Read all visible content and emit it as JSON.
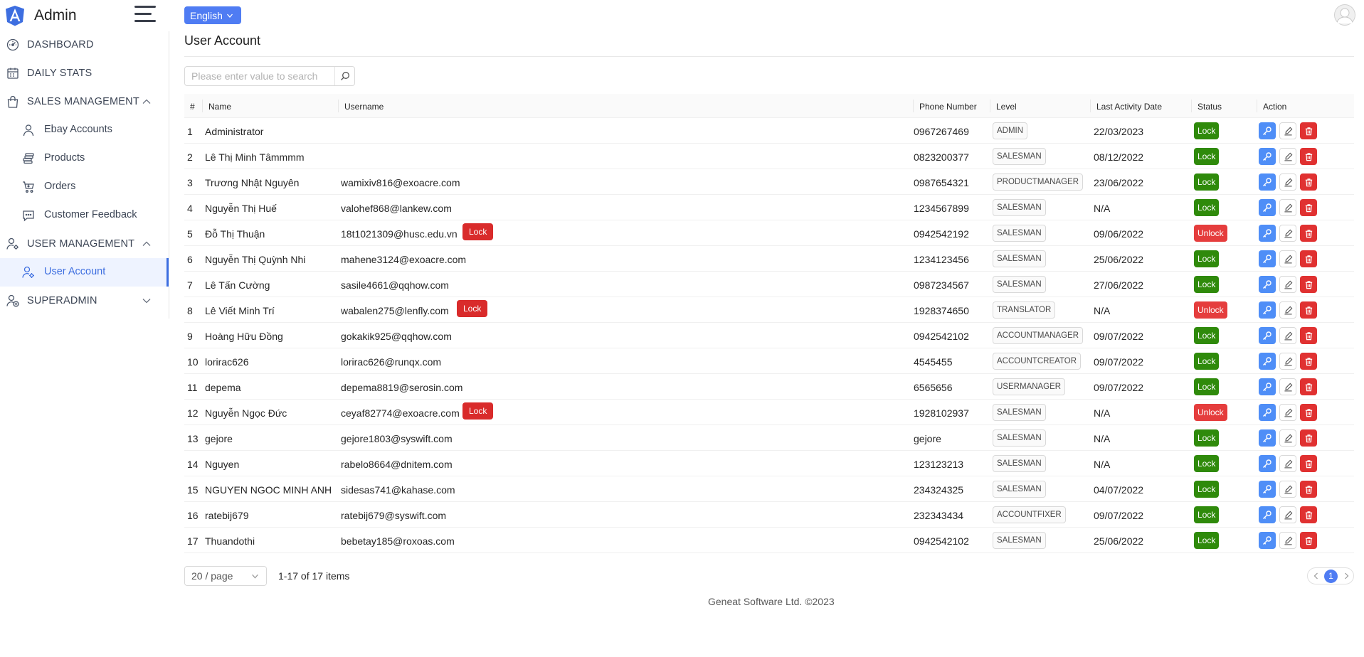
{
  "app": {
    "name": "Admin"
  },
  "header": {
    "language": "English"
  },
  "sidebar": {
    "items": [
      {
        "label": "DASHBOARD",
        "icon": "speedometer-icon"
      },
      {
        "label": "DAILY STATS",
        "icon": "calendar-icon"
      },
      {
        "label": "SALES MANAGEMENT",
        "icon": "shopping-bag-icon",
        "expanded": true,
        "children": [
          {
            "label": "Ebay Accounts",
            "icon": "user-icon"
          },
          {
            "label": "Products",
            "icon": "coins-icon"
          },
          {
            "label": "Orders",
            "icon": "cart-icon"
          },
          {
            "label": "Customer Feedback",
            "icon": "comment-icon"
          }
        ]
      },
      {
        "label": "USER MANAGEMENT",
        "icon": "user-gear-icon",
        "expanded": true,
        "children": [
          {
            "label": "User Account",
            "icon": "user-gear-icon",
            "active": true
          }
        ]
      },
      {
        "label": "SUPERADMIN",
        "icon": "user-plus-icon",
        "expanded": false
      }
    ]
  },
  "page": {
    "title": "User Account",
    "search_placeholder": "Please enter value to search"
  },
  "table": {
    "columns": [
      "#",
      "Name",
      "Username",
      "Phone Number",
      "Level",
      "Last Activity Date",
      "Status",
      "Action"
    ],
    "rows": [
      {
        "no": "1",
        "name": "Administrator",
        "username": "",
        "phone": "0967267469",
        "level": "ADMIN",
        "date": "22/03/2023",
        "status": "Lock",
        "locked": false
      },
      {
        "no": "2",
        "name": "Lê Thị Minh Tâmmmm",
        "username": "",
        "phone": "0823200377",
        "level": "SALESMAN",
        "date": "08/12/2022",
        "status": "Lock",
        "locked": false
      },
      {
        "no": "3",
        "name": "Trương Nhật Nguyên",
        "username": "wamixiv816@exoacre.com",
        "phone": "0987654321",
        "level": "PRODUCTMANAGER",
        "date": "23/06/2022",
        "status": "Lock",
        "locked": false
      },
      {
        "no": "4",
        "name": "Nguyễn Thị Huế",
        "username": "valohef868@lankew.com",
        "phone": "1234567899",
        "level": "SALESMAN",
        "date": "N/A",
        "status": "Lock",
        "locked": false
      },
      {
        "no": "5",
        "name": "Đỗ Thị Thuận",
        "username": "18t1021309@husc.edu.vn",
        "phone": "0942542192",
        "level": "SALESMAN",
        "date": "09/06/2022",
        "status": "Unlock",
        "locked": true,
        "lock_label": "Lock"
      },
      {
        "no": "6",
        "name": "Nguyễn Thị Quỳnh Nhi",
        "username": "mahene3124@exoacre.com",
        "phone": "1234123456",
        "level": "SALESMAN",
        "date": "25/06/2022",
        "status": "Lock",
        "locked": false
      },
      {
        "no": "7",
        "name": "Lê Tấn Cường",
        "username": "sasile4661@qqhow.com",
        "phone": "0987234567",
        "level": "SALESMAN",
        "date": "27/06/2022",
        "status": "Lock",
        "locked": false
      },
      {
        "no": "8",
        "name": "Lê Viết Minh Trí",
        "username": "wabalen275@lenfly.com",
        "phone": "1928374650",
        "level": "TRANSLATOR",
        "date": "N/A",
        "status": "Unlock",
        "locked": true,
        "lock_label": "Lock"
      },
      {
        "no": "9",
        "name": "Hoàng Hữu Đồng",
        "username": "gokakik925@qqhow.com",
        "phone": "0942542102",
        "level": "ACCOUNTMANAGER",
        "date": "09/07/2022",
        "status": "Lock",
        "locked": false
      },
      {
        "no": "10",
        "name": "lorirac626",
        "username": "lorirac626@runqx.com",
        "phone": "4545455",
        "level": "ACCOUNTCREATOR",
        "date": "09/07/2022",
        "status": "Lock",
        "locked": false
      },
      {
        "no": "11",
        "name": "depema",
        "username": "depema8819@serosin.com",
        "phone": "6565656",
        "level": "USERMANAGER",
        "date": "09/07/2022",
        "status": "Lock",
        "locked": false
      },
      {
        "no": "12",
        "name": "Nguyễn Ngọc Đức",
        "username": "ceyaf82774@exoacre.com",
        "phone": "1928102937",
        "level": "SALESMAN",
        "date": "N/A",
        "status": "Unlock",
        "locked": true,
        "lock_label": "Lock"
      },
      {
        "no": "13",
        "name": "gejore",
        "username": "gejore1803@syswift.com",
        "phone": "gejore",
        "level": "SALESMAN",
        "date": "N/A",
        "status": "Lock",
        "locked": false
      },
      {
        "no": "14",
        "name": "Nguyen",
        "username": "rabelo8664@dnitem.com",
        "phone": "123123213",
        "level": "SALESMAN",
        "date": "N/A",
        "status": "Lock",
        "locked": false
      },
      {
        "no": "15",
        "name": "NGUYEN NGOC MINH ANH",
        "username": "sidesas741@kahase.com",
        "phone": "234324325",
        "level": "SALESMAN",
        "date": "04/07/2022",
        "status": "Lock",
        "locked": false
      },
      {
        "no": "16",
        "name": "ratebij679",
        "username": "ratebij679@syswift.com",
        "phone": "232343434",
        "level": "ACCOUNTFIXER",
        "date": "09/07/2022",
        "status": "Lock",
        "locked": false
      },
      {
        "no": "17",
        "name": "Thuandothi",
        "username": "bebetay185@roxoas.com",
        "phone": "0942542102",
        "level": "SALESMAN",
        "date": "25/06/2022",
        "status": "Lock",
        "locked": false
      }
    ]
  },
  "pagination": {
    "page_size": "20 / page",
    "total": "1-17 of 17 items",
    "current": "1"
  },
  "footer": {
    "copyright": "Geneat Software Ltd. ©2023"
  },
  "colors": {
    "accent": "#4f7cf3",
    "lock_green": "#2f8a0b",
    "unlock_red": "#e53d3d",
    "delete_red": "#e03131",
    "key_blue": "#4f8ef7"
  }
}
